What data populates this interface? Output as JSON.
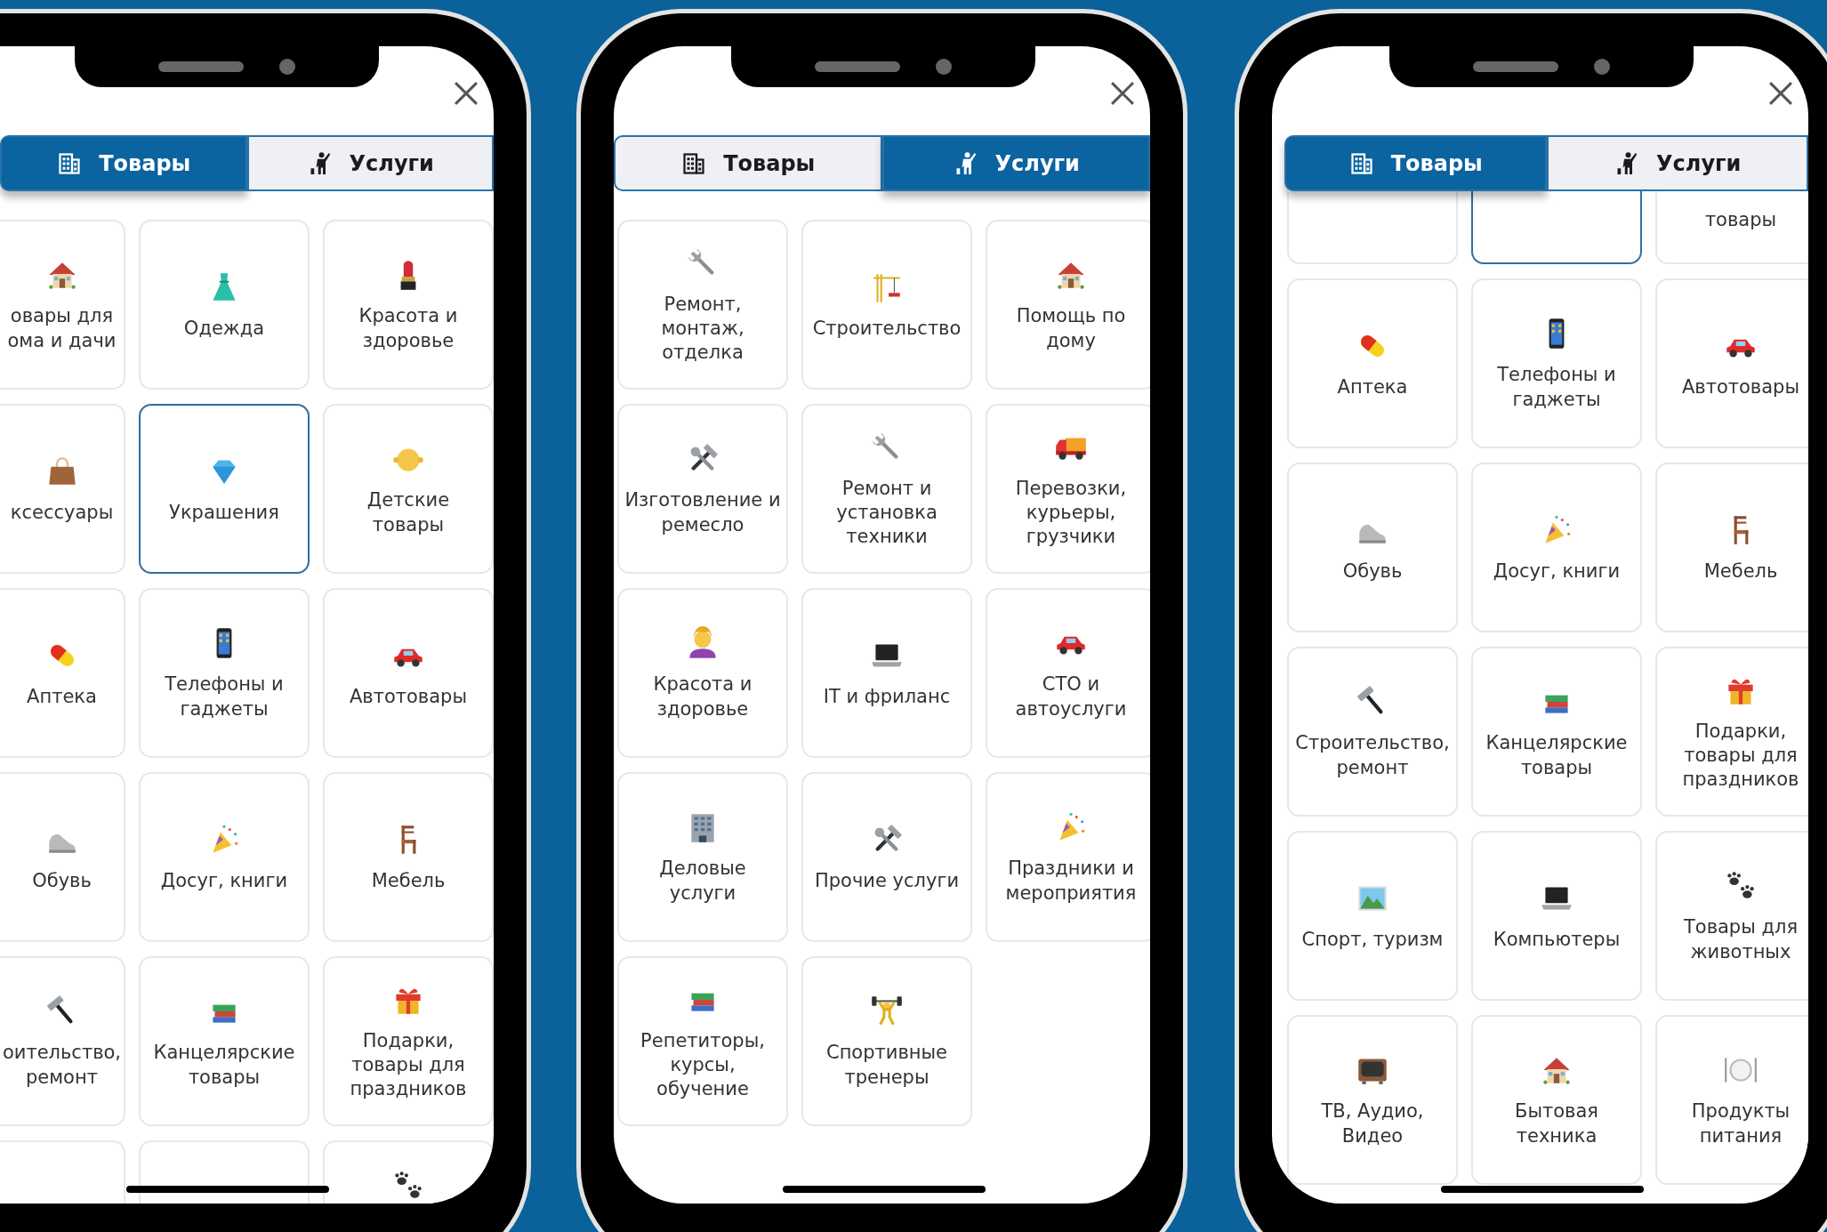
{
  "phones": [
    {
      "tabs": [
        {
          "label": "Товары",
          "kind": "goods",
          "selected": true
        },
        {
          "label": "Услуги",
          "kind": "services",
          "selected": false
        }
      ],
      "categories": [
        {
          "label": "овары для\nома и дачи",
          "kind": "house",
          "selected": false
        },
        {
          "label": "Одежда",
          "kind": "dress",
          "selected": false
        },
        {
          "label": "Красота и\nздоровье",
          "kind": "lipstick",
          "selected": false
        },
        {
          "label": "ксессуары",
          "kind": "handbag",
          "selected": false
        },
        {
          "label": "Украшения",
          "kind": "gem",
          "selected": true
        },
        {
          "label": "Детские\nтовары",
          "kind": "baby",
          "selected": false
        },
        {
          "label": "Аптека",
          "kind": "pill",
          "selected": false
        },
        {
          "label": "Телефоны и\nгаджеты",
          "kind": "smartphone",
          "selected": false
        },
        {
          "label": "Автотовары",
          "kind": "car",
          "selected": false
        },
        {
          "label": "Обувь",
          "kind": "shoe",
          "selected": false
        },
        {
          "label": "Досуг, книги",
          "kind": "party",
          "selected": false
        },
        {
          "label": "Мебель",
          "kind": "chair",
          "selected": false
        },
        {
          "label": "оительство,\nремонт",
          "kind": "hammer",
          "selected": false
        },
        {
          "label": "Канцелярские\nтовары",
          "kind": "books",
          "selected": false
        },
        {
          "label": "Подарки,\nтовары для\nпраздников",
          "kind": "gift",
          "selected": false
        },
        {
          "selected": false
        },
        {
          "selected": false
        },
        {
          "kind": "paw",
          "selected": false
        }
      ]
    },
    {
      "tabs": [
        {
          "label": "Товары",
          "kind": "goods",
          "selected": false
        },
        {
          "label": "Услуги",
          "kind": "services",
          "selected": true
        }
      ],
      "categories": [
        {
          "label": "Ремонт,\nмонтаж,\nотделка",
          "kind": "wrench",
          "selected": false
        },
        {
          "label": "Строительство",
          "kind": "crane",
          "selected": false
        },
        {
          "label": "Помощь по\nдому",
          "kind": "house",
          "selected": false
        },
        {
          "label": "Изготовление и\nремесло",
          "kind": "tools",
          "selected": false
        },
        {
          "label": "Ремонт и\nустановка\nтехники",
          "kind": "wrench",
          "selected": false
        },
        {
          "label": "Перевозки,\nкурьеры,\nгрузчики",
          "kind": "truck",
          "selected": false
        },
        {
          "label": "Красота и\nздоровье",
          "kind": "person",
          "selected": false
        },
        {
          "label": "IT и фриланс",
          "kind": "laptop",
          "selected": false
        },
        {
          "label": "СТО и\nавтоуслуги",
          "kind": "car",
          "selected": false
        },
        {
          "label": "Деловые\nуслуги",
          "kind": "office",
          "selected": false
        },
        {
          "label": "Прочие услуги",
          "kind": "tools",
          "selected": false
        },
        {
          "label": "Праздники и\nмероприятия",
          "kind": "party",
          "selected": false
        },
        {
          "label": "Репетиторы,\nкурсы,\nобучение",
          "kind": "books",
          "selected": false
        },
        {
          "label": "Спортивные\nтренеры",
          "kind": "weightlifter",
          "selected": false
        }
      ]
    },
    {
      "tabs": [
        {
          "label": "Товары",
          "kind": "goods",
          "selected": true
        },
        {
          "label": "Услуги",
          "kind": "services",
          "selected": false
        }
      ],
      "categories": [
        {
          "selected": false
        },
        {
          "selected": true
        },
        {
          "label": "товары",
          "selected": false
        },
        {
          "label": "Аптека",
          "kind": "pill",
          "selected": false
        },
        {
          "label": "Телефоны и\nгаджеты",
          "kind": "smartphone",
          "selected": false
        },
        {
          "label": "Автотовары",
          "kind": "car",
          "selected": false
        },
        {
          "label": "Обувь",
          "kind": "shoe",
          "selected": false
        },
        {
          "label": "Досуг, книги",
          "kind": "party",
          "selected": false
        },
        {
          "label": "Мебель",
          "kind": "chair",
          "selected": false
        },
        {
          "label": "Строительство,\nремонт",
          "kind": "hammer",
          "selected": false
        },
        {
          "label": "Канцелярские\nтовары",
          "kind": "books",
          "selected": false
        },
        {
          "label": "Подарки,\nтовары для\nпраздников",
          "kind": "gift",
          "selected": false
        },
        {
          "label": "Спорт, туризм",
          "kind": "landscape",
          "selected": false
        },
        {
          "label": "Компьютеры",
          "kind": "laptop",
          "selected": false
        },
        {
          "label": "Товары для\nживотных",
          "kind": "paw",
          "selected": false
        },
        {
          "label": "ТВ, Аудио,\nВидео",
          "kind": "tv",
          "selected": false
        },
        {
          "label": "Бытовая\nтехника",
          "kind": "house",
          "selected": false
        },
        {
          "label": "Продукты\nпитания",
          "kind": "plate",
          "selected": false
        }
      ]
    }
  ]
}
